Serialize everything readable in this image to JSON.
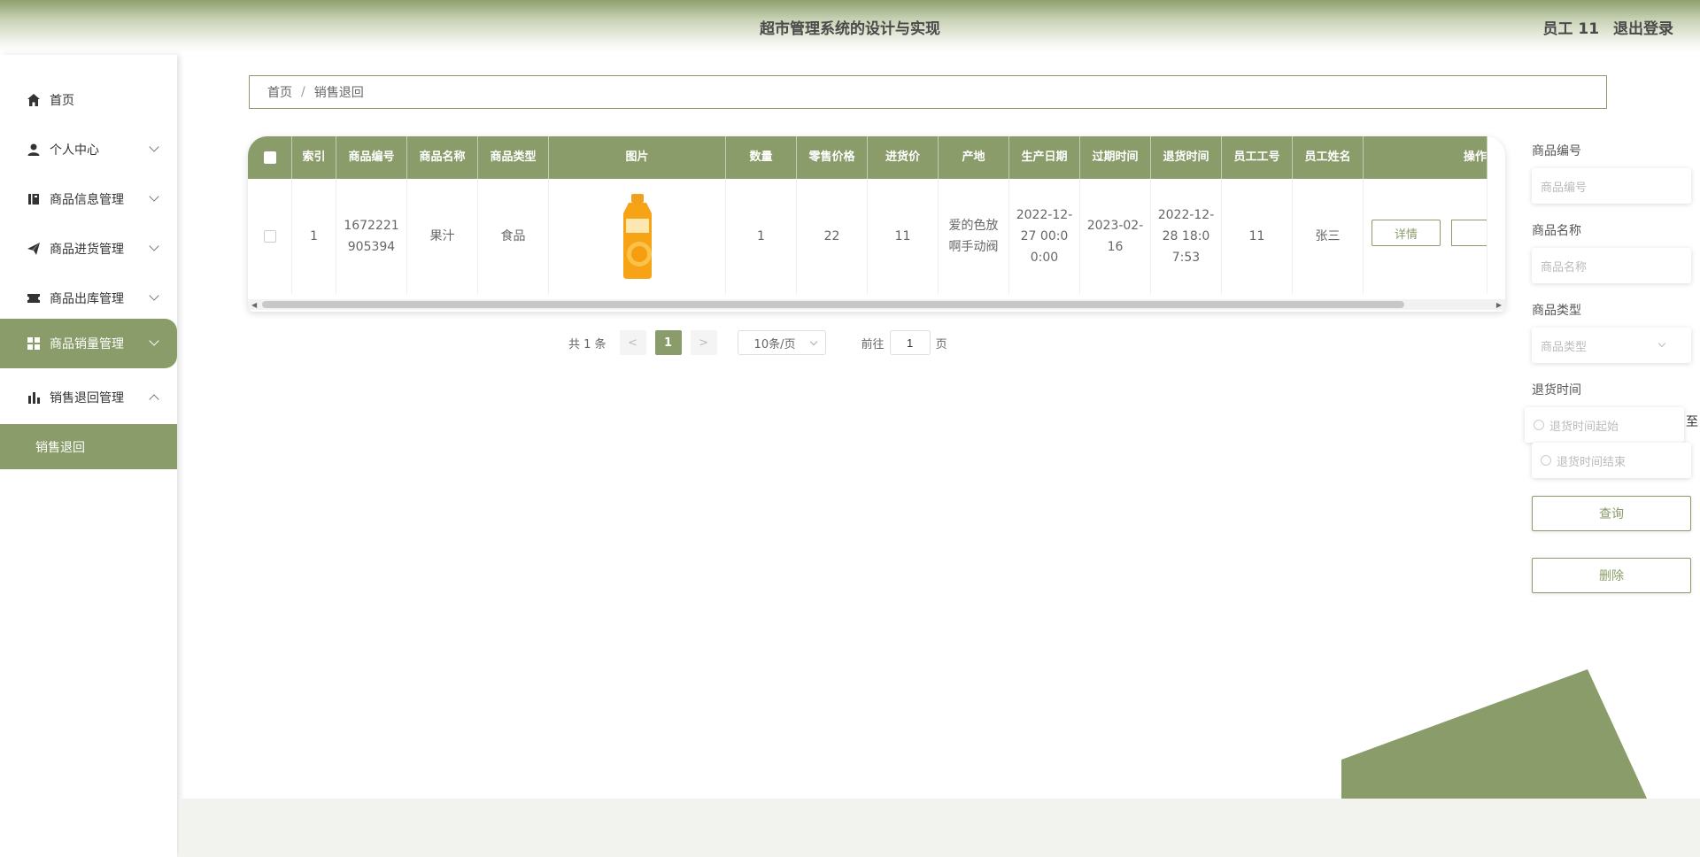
{
  "app": {
    "title": "超市管理系统的设计与实现",
    "user_label": "员工 11",
    "logout_label": "退出登录",
    "accent_color": "#8a9c69"
  },
  "sidebar": {
    "items": [
      {
        "label": "首页",
        "icon": "home-icon",
        "has_children": false
      },
      {
        "label": "个人中心",
        "icon": "user-icon",
        "has_children": true
      },
      {
        "label": "商品信息管理",
        "icon": "book-icon",
        "has_children": true
      },
      {
        "label": "商品进货管理",
        "icon": "send-icon",
        "has_children": true
      },
      {
        "label": "商品出库管理",
        "icon": "ticket-icon",
        "has_children": true
      },
      {
        "label": "商品销量管理",
        "icon": "grid-icon",
        "has_children": true,
        "active": true
      },
      {
        "label": "销售退回管理",
        "icon": "bar-chart-icon",
        "has_children": true,
        "expanded": true
      }
    ],
    "submenu": {
      "label": "销售退回"
    }
  },
  "breadcrumb": {
    "home": "首页",
    "current": "销售退回"
  },
  "table": {
    "columns": [
      "索引",
      "商品编号",
      "商品名称",
      "商品类型",
      "图片",
      "数量",
      "零售价格",
      "进货价",
      "产地",
      "生产日期",
      "过期时间",
      "退货时间",
      "员工工号",
      "员工姓名",
      "操作"
    ],
    "rows": [
      {
        "index": "1",
        "product_no": "1672221905394",
        "product_name": "果汁",
        "product_type": "食品",
        "quantity": "1",
        "retail_price": "22",
        "purchase_price": "11",
        "origin": "爱的色放啊手动阀",
        "production_date": "2022-12-27 00:00:00",
        "expiry_date": "2023-02-16",
        "return_time": "2022-12-28 18:07:53",
        "employee_no": "11",
        "employee_name": "张三",
        "detail_label": "详情"
      }
    ]
  },
  "pagination": {
    "total": "共 1 条",
    "prev": "<",
    "page": "1",
    "next": ">",
    "page_size": "10条/页",
    "goto_prefix": "前往",
    "goto_value": "1",
    "goto_suffix": "页"
  },
  "search": {
    "product_no_label": "商品编号",
    "product_no_placeholder": "商品编号",
    "product_name_label": "商品名称",
    "product_name_placeholder": "商品名称",
    "product_type_label": "商品类型",
    "product_type_placeholder": "商品类型",
    "return_time_label": "退货时间",
    "return_start_placeholder": "退货时间起始",
    "range_sep": "至",
    "return_end_placeholder": "退货时间结束",
    "query_label": "查询",
    "delete_label": "删除"
  }
}
